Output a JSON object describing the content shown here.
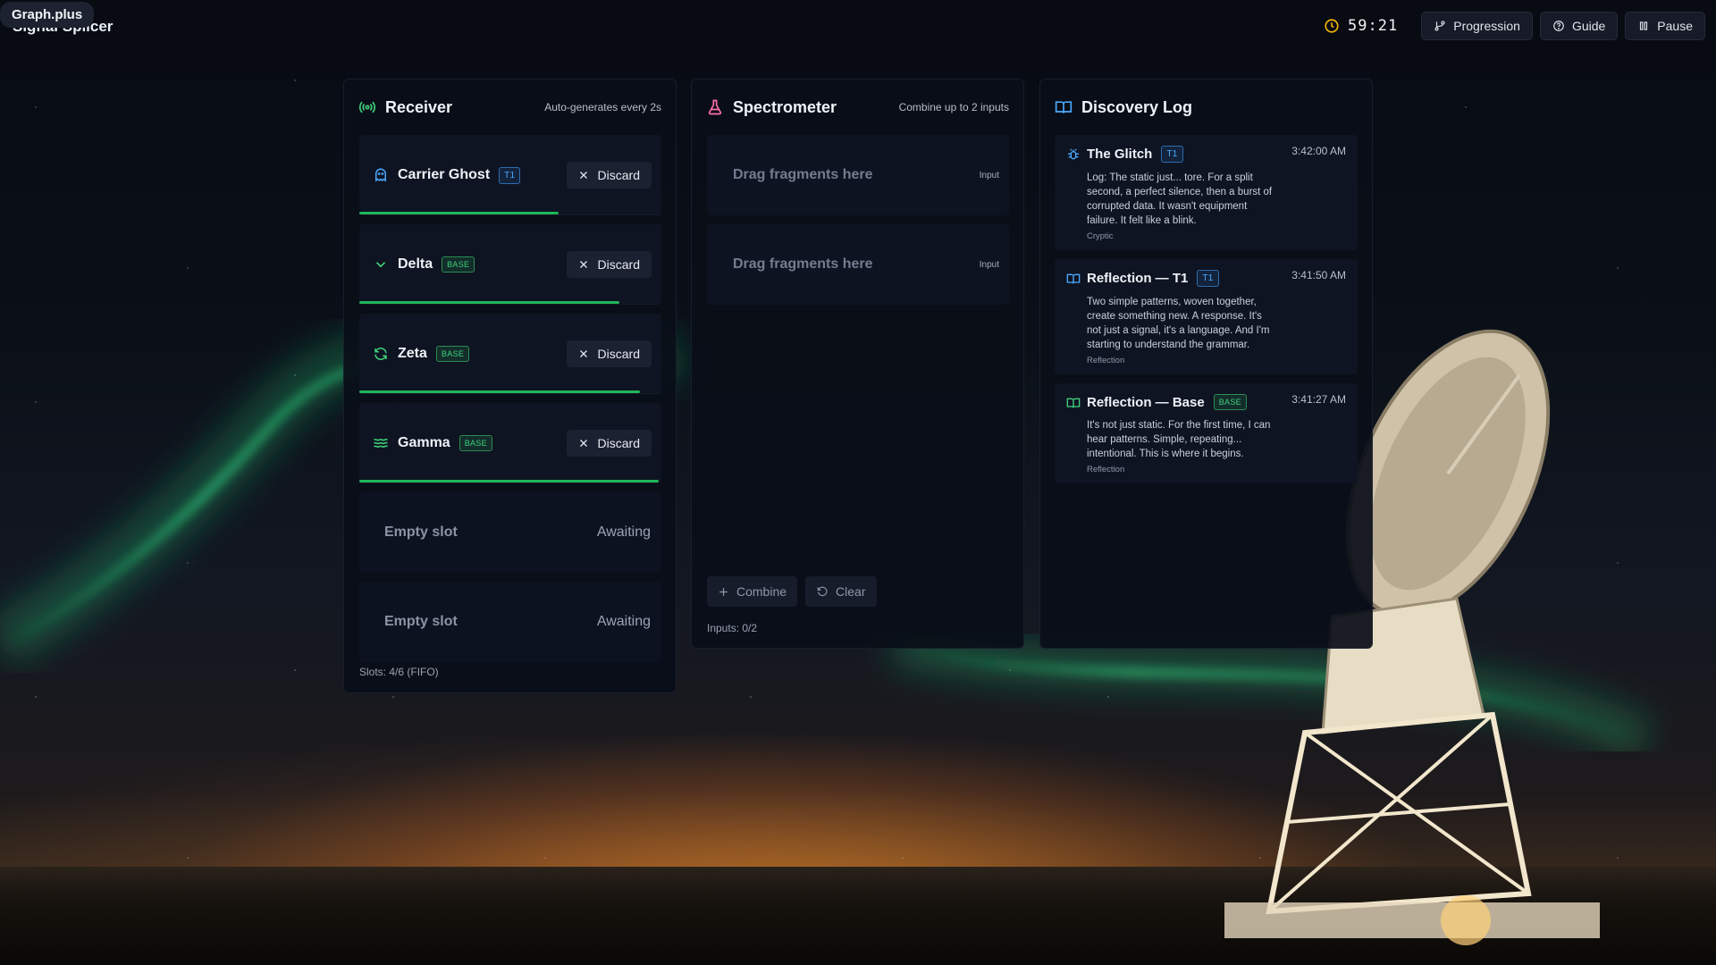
{
  "brand": "Graph.plus",
  "app": {
    "title": "Signal Splicer"
  },
  "topbar": {
    "timer": "59:21",
    "progression_label": "Progression",
    "guide_label": "Guide",
    "pause_label": "Pause"
  },
  "receiver": {
    "title": "Receiver",
    "subtitle": "Auto-generates every 2s",
    "fragments": [
      {
        "name": "Carrier Ghost",
        "tier": "T1",
        "icon": "ghost-icon",
        "discard_label": "Discard",
        "progress": 0.66
      },
      {
        "name": "Delta",
        "tier": "BASE",
        "icon": "chevron-down-icon",
        "discard_label": "Discard",
        "progress": 0.86
      },
      {
        "name": "Zeta",
        "tier": "BASE",
        "icon": "refresh-icon",
        "discard_label": "Discard",
        "progress": 0.93
      },
      {
        "name": "Gamma",
        "tier": "BASE",
        "icon": "waves-icon",
        "discard_label": "Discard",
        "progress": 0.99
      }
    ],
    "empty_slots": [
      {
        "label": "Empty slot",
        "status": "Awaiting"
      },
      {
        "label": "Empty slot",
        "status": "Awaiting"
      }
    ],
    "footer": "Slots: 4/6 (FIFO)"
  },
  "spectrometer": {
    "title": "Spectrometer",
    "subtitle": "Combine up to 2 inputs",
    "drop_zones": [
      {
        "text": "Drag fragments here",
        "tag": "Input"
      },
      {
        "text": "Drag fragments here",
        "tag": "Input"
      }
    ],
    "combine_label": "Combine",
    "clear_label": "Clear",
    "footer": "Inputs: 0/2"
  },
  "discovery": {
    "title": "Discovery Log",
    "entries": [
      {
        "title": "The Glitch",
        "tier": "T1",
        "time": "3:42:00 AM",
        "text": "Log: The static just... tore. For a split second, a perfect silence, then a burst of corrupted data. It wasn't equipment failure. It felt like a blink.",
        "category": "Cryptic",
        "icon": "bug-icon"
      },
      {
        "title": "Reflection — T1",
        "tier": "T1",
        "time": "3:41:50 AM",
        "text": "Two simple patterns, woven together, create something new. A response. It's not just a signal, it's a language. And I'm starting to understand the grammar.",
        "category": "Reflection",
        "icon": "book-icon"
      },
      {
        "title": "Reflection — Base",
        "tier": "BASE",
        "time": "3:41:27 AM",
        "text": "It's not just static. For the first time, I can hear patterns. Simple, repeating... intentional. This is where it begins.",
        "category": "Reflection",
        "icon": "book-icon"
      }
    ]
  },
  "colors": {
    "accent_green": "#21b65a",
    "tier_t1": "#4aa9ff",
    "tier_base": "#3fd17a",
    "timer_icon": "#f5b700",
    "spectrometer_icon": "#ff6fa8"
  }
}
